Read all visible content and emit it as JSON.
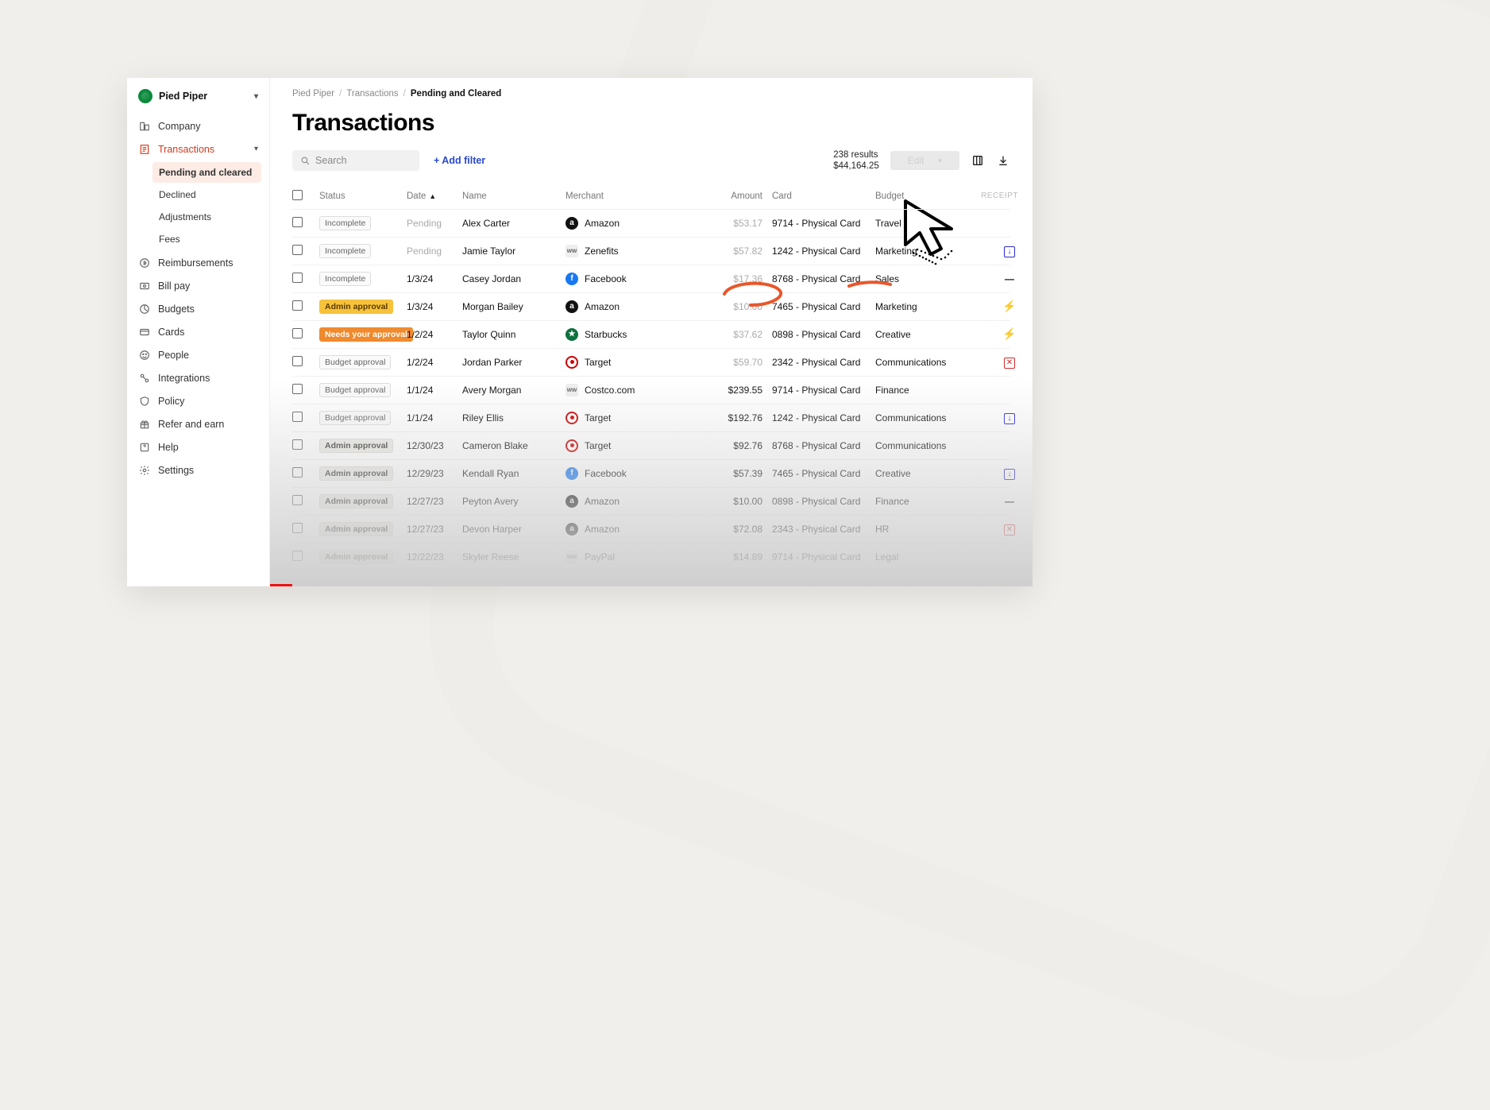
{
  "org": {
    "name": "Pied Piper"
  },
  "sidebar": {
    "company": "Company",
    "transactions": "Transactions",
    "sub": {
      "pending": "Pending and cleared",
      "declined": "Declined",
      "adjustments": "Adjustments",
      "fees": "Fees"
    },
    "reimbursements": "Reimbursements",
    "billpay": "Bill pay",
    "budgets": "Budgets",
    "cards": "Cards",
    "people": "People",
    "integrations": "Integrations",
    "policy": "Policy",
    "refer": "Refer and earn",
    "help": "Help",
    "settings": "Settings"
  },
  "breadcrumb": {
    "a": "Pied Piper",
    "b": "Transactions",
    "c": "Pending and Cleared"
  },
  "page_title": "Transactions",
  "search_placeholder": "Search",
  "add_filter": "+ Add filter",
  "summary": {
    "count": "238 results",
    "total": "$44,164.25"
  },
  "edit_label": "Edit",
  "columns": {
    "status": "Status",
    "date": "Date",
    "name": "Name",
    "merchant": "Merchant",
    "amount": "Amount",
    "card": "Card",
    "budget": "Budget",
    "receipt": "RECEIPT"
  },
  "status_labels": {
    "incomplete": "Incomplete",
    "admin": "Admin approval",
    "needs": "Needs your approval",
    "budget": "Budget approval"
  },
  "rows": [
    {
      "status": "incomplete",
      "date": "Pending",
      "name": "Alex Carter",
      "merchant": "Amazon",
      "mkey": "amazon",
      "amount": "$53.17",
      "pend": true,
      "card": "9714 - Physical Card",
      "budget": "Travel",
      "receipt": ""
    },
    {
      "status": "incomplete",
      "date": "Pending",
      "name": "Jamie Taylor",
      "merchant": "Zenefits",
      "mkey": "zenefits",
      "amount": "$57.82",
      "pend": true,
      "card": "1242 - Physical Card",
      "budget": "Marketing",
      "receipt": "down"
    },
    {
      "status": "incomplete",
      "date": "1/3/24",
      "name": "Casey Jordan",
      "merchant": "Facebook",
      "mkey": "facebook",
      "amount": "$17.36",
      "pend": true,
      "card": "8768 - Physical Card",
      "budget": "Sales",
      "receipt": "dash"
    },
    {
      "status": "admin",
      "date": "1/3/24",
      "name": "Morgan Bailey",
      "merchant": "Amazon",
      "mkey": "amazon",
      "amount": "$10.00",
      "pend": true,
      "card": "7465 - Physical Card",
      "budget": "Marketing",
      "receipt": "bolt"
    },
    {
      "status": "needs",
      "date": "1/2/24",
      "name": "Taylor Quinn",
      "merchant": "Starbucks",
      "mkey": "starbucks",
      "amount": "$37.62",
      "pend": true,
      "card": "0898 - Physical Card",
      "budget": "Creative",
      "receipt": "bolt"
    },
    {
      "status": "budget",
      "date": "1/2/24",
      "name": "Jordan Parker",
      "merchant": "Target",
      "mkey": "target",
      "amount": "$59.70",
      "pend": true,
      "card": "2342 - Physical Card",
      "budget": "Communications",
      "receipt": "x"
    },
    {
      "status": "budget",
      "date": "1/1/24",
      "name": "Avery Morgan",
      "merchant": "Costco.com",
      "mkey": "costco",
      "amount": "$239.55",
      "pend": false,
      "card": "9714 - Physical Card",
      "budget": "Finance",
      "receipt": ""
    },
    {
      "status": "budget",
      "date": "1/1/24",
      "name": "Riley Ellis",
      "merchant": "Target",
      "mkey": "target",
      "amount": "$192.76",
      "pend": false,
      "card": "1242 - Physical Card",
      "budget": "Communications",
      "receipt": "down"
    },
    {
      "status": "admin",
      "date": "12/30/23",
      "name": "Cameron Blake",
      "merchant": "Target",
      "mkey": "target",
      "amount": "$92.76",
      "pend": false,
      "card": "8768 - Physical Card",
      "budget": "Communications",
      "receipt": ""
    },
    {
      "status": "admin",
      "date": "12/29/23",
      "name": "Kendall Ryan",
      "merchant": "Facebook",
      "mkey": "facebook",
      "amount": "$57.39",
      "pend": false,
      "card": "7465 - Physical Card",
      "budget": "Creative",
      "receipt": "down"
    },
    {
      "status": "admin",
      "date": "12/27/23",
      "name": "Peyton Avery",
      "merchant": "Amazon",
      "mkey": "amazon",
      "amount": "$10.00",
      "pend": false,
      "card": "0898 - Physical Card",
      "budget": "Finance",
      "receipt": "dash"
    },
    {
      "status": "admin",
      "date": "12/27/23",
      "name": "Devon Harper",
      "merchant": "Amazon",
      "mkey": "amazon",
      "amount": "$72.08",
      "pend": false,
      "card": "2343 - Physical Card",
      "budget": "HR",
      "receipt": "x"
    },
    {
      "status": "admin",
      "date": "12/22/23",
      "name": "Skyler Reese",
      "merchant": "PayPal",
      "mkey": "paypal",
      "amount": "$14.89",
      "pend": false,
      "card": "9714 - Physical Card",
      "budget": "Legal",
      "receipt": ""
    }
  ]
}
